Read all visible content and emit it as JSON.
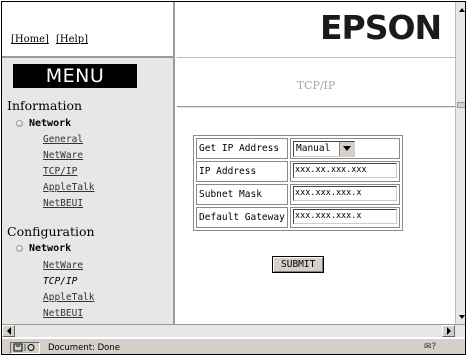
{
  "topnav": {
    "home": "[Home]",
    "help": "[Help]"
  },
  "menu": {
    "banner": "MENU",
    "information": {
      "heading": "Information",
      "group": "Network",
      "items": [
        "General",
        "NetWare",
        "TCP/IP",
        "AppleTalk",
        "NetBEUI"
      ]
    },
    "configuration": {
      "heading": "Configuration",
      "group": "Network",
      "items": [
        "NetWare",
        "TCP/IP",
        "AppleTalk",
        "NetBEUI"
      ],
      "current": "TCP/IP"
    }
  },
  "main": {
    "logo": "EPSON",
    "title": "TCP/IP",
    "form": {
      "get_ip_label": "Get IP Address",
      "get_ip_value": "Manual",
      "ip_label": "IP Address",
      "ip_value": "xxx.xx.xxx.xxx",
      "subnet_label": "Subnet Mask",
      "subnet_value": "xxx.xxx.xxx.x",
      "gateway_label": "Default Gateway",
      "gateway_value": "xxx.xxx.xxx.x"
    },
    "submit": "SUBMIT"
  },
  "statusbar": {
    "text": "Document: Done"
  },
  "icons": {
    "status": "page-status-icon",
    "scroll_up": "chevron-up-icon",
    "scroll_down": "chevron-down-icon"
  }
}
